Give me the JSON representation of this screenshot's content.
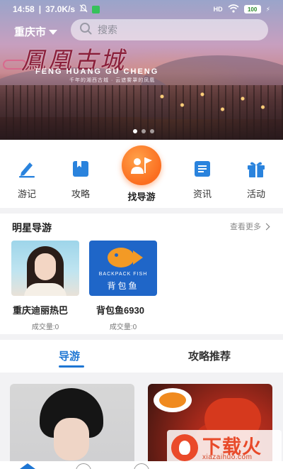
{
  "status_bar": {
    "time": "14:58",
    "speed": "37.0K/s",
    "signal": "HD",
    "battery": "100"
  },
  "header": {
    "city": "重庆市",
    "search_placeholder": "搜索"
  },
  "banner": {
    "title": "鳳凰古城",
    "subtitle": "FENG HUANG GU CHENG",
    "small_text": "千年的湘西古城 · 云遮雾罩的凤凰",
    "slides": 3,
    "active_slide": 1
  },
  "nav": {
    "items": [
      {
        "label": "游记",
        "icon": "edit-pen-icon"
      },
      {
        "label": "攻略",
        "icon": "book-icon"
      },
      {
        "label": "找导游",
        "icon": "guide-flag-icon"
      },
      {
        "label": "资讯",
        "icon": "news-doc-icon"
      },
      {
        "label": "活动",
        "icon": "gift-icon"
      }
    ]
  },
  "star_guides": {
    "title": "明星导游",
    "more": "查看更多",
    "cards": [
      {
        "name": "重庆迪丽热巴",
        "deals": "成交量:0"
      },
      {
        "name": "背包鱼6930",
        "deals": "成交量:0",
        "logo_en": "BACKPACK FISH",
        "logo_cn": "背包鱼"
      }
    ]
  },
  "tabs": {
    "active": "导游",
    "inactive": "攻略推荐"
  },
  "watermark": {
    "name": "下载火",
    "url": "xiazaihuo.com"
  },
  "colors": {
    "accent": "#1e76d3",
    "orange": "#fb6d1f"
  }
}
